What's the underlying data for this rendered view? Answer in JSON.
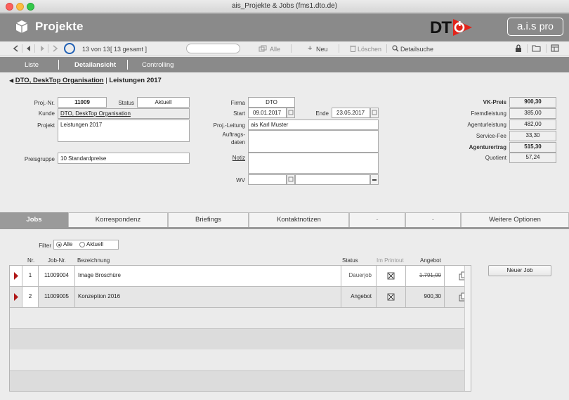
{
  "window": {
    "title": "ais_Projekte & Jobs (fms1.dto.de)"
  },
  "header": {
    "title": "Projekte",
    "logo_text": "DT",
    "ais_brand": "a.i.s",
    "ais_pro": "pro"
  },
  "toolbar": {
    "record_position": "13 von 13",
    "record_total": "[ 13 gesamt ]",
    "all_label": "Alle",
    "new_label": "Neu",
    "delete_label": "Löschen",
    "detail_search_label": "Detailsuche",
    "search_placeholder": ""
  },
  "nav_tabs": [
    {
      "label": "Liste"
    },
    {
      "label": "Detailansicht"
    },
    {
      "label": "Controlling"
    }
  ],
  "breadcrumb": {
    "customer": "DTO, DeskTop Organisation",
    "sep": "|",
    "project": "Leistungen 2017"
  },
  "form": {
    "proj_nr_label": "Proj.-Nr.",
    "proj_nr": "11009",
    "status_label": "Status",
    "status": "Aktuell",
    "kunde_label": "Kunde",
    "kunde": "DTO, DeskTop Organisation",
    "projekt_label": "Projekt",
    "projekt": "Leistungen 2017",
    "preisgruppe_label": "Preisgruppe",
    "preisgruppe": "10 Standardpreise",
    "firma_label": "Firma",
    "firma": "DTO",
    "start_label": "Start",
    "start": "09.01.2017",
    "ende_label": "Ende",
    "ende": "23.05.2017",
    "projleitung_label": "Proj.-Leitung",
    "projleitung": "ais Karl Muster",
    "auftragsdaten_label_1": "Auftrags-",
    "auftragsdaten_label_2": "daten",
    "notiz_label": "Notiz",
    "wv_label": "WV"
  },
  "summary": [
    {
      "label": "VK-Preis",
      "value": "900,30",
      "bold": true
    },
    {
      "label": "Fremdleistung",
      "value": "385,00",
      "bold": false
    },
    {
      "label": "Agenturleistung",
      "value": "482,00",
      "bold": false
    },
    {
      "label": "Service-Fee",
      "value": "33,30",
      "bold": false
    },
    {
      "label": "Agenturertrag",
      "value": "515,30",
      "bold": true
    },
    {
      "label": "Quotient",
      "value": "57,24",
      "bold": false
    }
  ],
  "bottom_tabs": [
    {
      "label": "Jobs"
    },
    {
      "label": "Korrespondenz"
    },
    {
      "label": "Briefings"
    },
    {
      "label": "Kontaktnotizen"
    },
    {
      "label": "-"
    },
    {
      "label": "-"
    },
    {
      "label": "Weitere Optionen"
    }
  ],
  "filter": {
    "label": "Filter",
    "opt_all": "Alle",
    "opt_current": "Aktuell",
    "selected": "Alle"
  },
  "jobs_table": {
    "headers": {
      "nr": "Nr.",
      "job_nr": "Job-Nr.",
      "bezeichnung": "Bezeichnung",
      "status": "Status",
      "im_printout": "Im Printout",
      "angebot": "Angebot"
    },
    "rows": [
      {
        "nr": "1",
        "job_nr": "11009004",
        "bezeichnung": "Image Broschüre",
        "status": "Dauerjob",
        "im_printout": true,
        "angebot": "1.791,00",
        "angebot_struck": true
      },
      {
        "nr": "2",
        "job_nr": "11009005",
        "bezeichnung": "Konzeption 2016",
        "status": "Angebot",
        "im_printout": true,
        "angebot": "900,30",
        "angebot_struck": false
      }
    ]
  },
  "new_job_button": "Neuer Job",
  "colors": {
    "header_gray": "#8a8a8a",
    "accent_red": "#e2231a",
    "row_marker": "#b01818"
  }
}
